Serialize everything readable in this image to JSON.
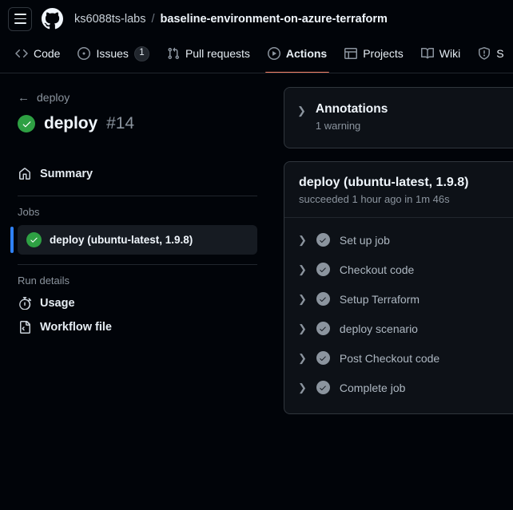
{
  "header": {
    "menu_icon": "hamburger-icon",
    "logo_icon": "github-logo-icon",
    "breadcrumb": {
      "owner": "ks6088ts-labs",
      "separator": "/",
      "repo": "baseline-environment-on-azure-terraform"
    }
  },
  "repo_nav": {
    "tabs": [
      {
        "label": "Code",
        "icon": "code-icon",
        "selected": false,
        "badge": null
      },
      {
        "label": "Issues",
        "icon": "issue-opened-icon",
        "selected": false,
        "badge": "1"
      },
      {
        "label": "Pull requests",
        "icon": "git-pull-request-icon",
        "selected": false,
        "badge": null
      },
      {
        "label": "Actions",
        "icon": "play-circle-icon",
        "selected": true,
        "badge": null
      },
      {
        "label": "Projects",
        "icon": "table-icon",
        "selected": false,
        "badge": null
      },
      {
        "label": "Wiki",
        "icon": "book-icon",
        "selected": false,
        "badge": null
      },
      {
        "label": "S",
        "icon": "shield-icon",
        "selected": false,
        "badge": null
      }
    ]
  },
  "sidebar": {
    "back_link": {
      "label": "deploy",
      "icon": "arrow-left-icon"
    },
    "run_title": {
      "status_icon": "check-circle-fill-icon",
      "name": "deploy",
      "run_number": "#14"
    },
    "summary": {
      "label": "Summary",
      "icon": "home-icon"
    },
    "jobs_label": "Jobs",
    "jobs": [
      {
        "label": "deploy (ubuntu-latest, 1.9.8)",
        "status_icon": "check-circle-fill-icon",
        "selected": true
      }
    ],
    "run_details_label": "Run details",
    "run_details": [
      {
        "label": "Usage",
        "icon": "stopwatch-icon"
      },
      {
        "label": "Workflow file",
        "icon": "workflow-file-icon"
      }
    ]
  },
  "main": {
    "annotations": {
      "chevron": "chevron-right-icon",
      "title": "Annotations",
      "subtitle": "1 warning"
    },
    "job": {
      "name": "deploy (ubuntu-latest, 1.9.8)",
      "meta": "succeeded 1 hour ago in 1m 46s",
      "steps": [
        {
          "label": "Set up job",
          "status_icon": "check-circle-icon",
          "chevron": "chevron-right-icon"
        },
        {
          "label": "Checkout code",
          "status_icon": "check-circle-icon",
          "chevron": "chevron-right-icon"
        },
        {
          "label": "Setup Terraform",
          "status_icon": "check-circle-icon",
          "chevron": "chevron-right-icon"
        },
        {
          "label": "deploy scenario",
          "status_icon": "check-circle-icon",
          "chevron": "chevron-right-icon"
        },
        {
          "label": "Post Checkout code",
          "status_icon": "check-circle-icon",
          "chevron": "chevron-right-icon"
        },
        {
          "label": "Complete job",
          "status_icon": "check-circle-icon",
          "chevron": "chevron-right-icon"
        }
      ]
    }
  },
  "colors": {
    "page_background": "#010409",
    "card_background": "#0d1117",
    "card_border": "#30363d",
    "accent_underline": "#f78166",
    "success_green": "#2ea043",
    "selected_job_bar": "#2f81f7",
    "muted_text": "#8b949e"
  }
}
